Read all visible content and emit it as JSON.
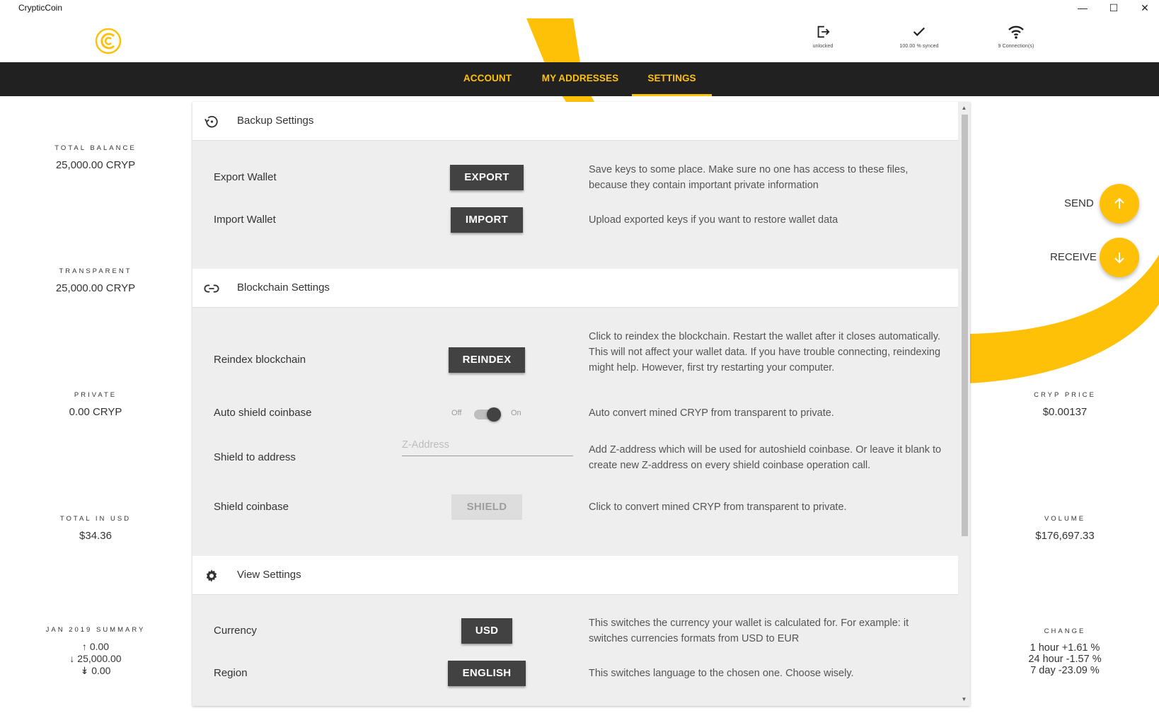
{
  "app": {
    "title": "CrypticCoin"
  },
  "window_controls": {
    "minimize": "—",
    "maximize": "☐",
    "close": "✕"
  },
  "status": {
    "lock": {
      "label": "unlocked",
      "icon": "logout-icon"
    },
    "sync": {
      "label": "100.00 % synced",
      "icon": "check-icon"
    },
    "connections": {
      "label": "9 Connection(s)",
      "icon": "wifi-icon"
    }
  },
  "nav": {
    "tabs": [
      {
        "label": "ACCOUNT"
      },
      {
        "label": "MY ADDRESSES"
      },
      {
        "label": "SETTINGS",
        "active": true
      }
    ]
  },
  "balances": {
    "total_balance": {
      "label": "TOTAL BALANCE",
      "value": "25,000.00 CRYP"
    },
    "transparent": {
      "label": "TRANSPARENT",
      "value": "25,000.00 CRYP"
    },
    "private": {
      "label": "PRIVATE",
      "value": "0.00 CRYP"
    },
    "total_usd": {
      "label": "TOTAL IN USD",
      "value": "$34.36"
    },
    "summary": {
      "label": "JAN 2019 SUMMARY",
      "lines": [
        "0.00",
        "25,000.00",
        "0.00"
      ]
    }
  },
  "settings": {
    "backup": {
      "title": "Backup Settings",
      "rows": [
        {
          "label": "Export Wallet",
          "button": "EXPORT",
          "desc": "Save keys to some place. Make sure no one has access to these files, because they contain important private information"
        },
        {
          "label": "Import Wallet",
          "button": "IMPORT",
          "desc": "Upload exported keys if you want to restore wallet data"
        }
      ]
    },
    "blockchain": {
      "title": "Blockchain Settings",
      "reindex": {
        "label": "Reindex blockchain",
        "button": "REINDEX",
        "desc": "Click to reindex the blockchain. Restart the wallet after it closes automatically. This will not affect your wallet data. If you have trouble connecting, reindexing might help. However, first try restarting your computer."
      },
      "auto_shield": {
        "label": "Auto shield coinbase",
        "off": "Off",
        "on": "On",
        "enabled": true,
        "desc": "Auto convert mined CRYP from transparent to private."
      },
      "shield_address": {
        "label": "Shield to address",
        "placeholder": "Z-Address",
        "value": "",
        "desc": "Add Z-address which will be used for autoshield coinbase. Or leave it blank to create new Z-address on every shield coinbase operation call."
      },
      "shield_coinbase": {
        "label": "Shield coinbase",
        "button": "SHIELD",
        "disabled": true,
        "desc": "Click to convert mined CRYP from transparent to private."
      }
    },
    "view": {
      "title": "View Settings",
      "currency": {
        "label": "Currency",
        "button": "USD",
        "desc": "This switches the currency your wallet is calculated for. For example: it switches currencies formats from USD to EUR"
      },
      "region": {
        "label": "Region",
        "button": "ENGLISH",
        "desc": "This switches language to the chosen one. Choose wisely."
      }
    }
  },
  "actions": {
    "send": "SEND",
    "receive": "RECEIVE"
  },
  "market": {
    "price": {
      "label": "CRYP PRICE",
      "value": "$0.00137"
    },
    "volume": {
      "label": "VOLUME",
      "value": "$176,697.33"
    },
    "change": {
      "label": "CHANGE",
      "lines": [
        "1 hour +1.61 %",
        "24 hour -1.57 %",
        "7 day -23.09 %"
      ]
    }
  },
  "colors": {
    "accent": "#ffc107",
    "navbar": "#212121",
    "button": "#424242",
    "panel": "#eeeeee"
  }
}
